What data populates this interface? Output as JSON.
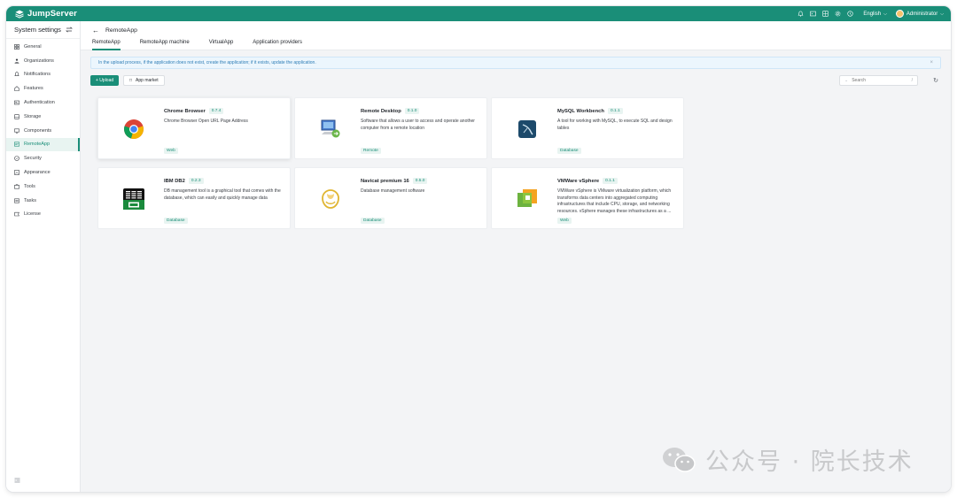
{
  "topbar": {
    "brand": "JumpServer",
    "language": "English",
    "user": "Administrator",
    "icons": [
      "bell-icon",
      "terminal-icon",
      "grid-icon",
      "gear-icon",
      "help-icon"
    ]
  },
  "sidebar": {
    "title": "System settings",
    "items": [
      {
        "label": "General",
        "icon": "general-icon"
      },
      {
        "label": "Organizations",
        "icon": "organizations-icon"
      },
      {
        "label": "Notifications",
        "icon": "bell-icon"
      },
      {
        "label": "Features",
        "icon": "home-icon"
      },
      {
        "label": "Authentication",
        "icon": "id-card-icon"
      },
      {
        "label": "Storage",
        "icon": "storage-icon"
      },
      {
        "label": "Components",
        "icon": "components-icon"
      },
      {
        "label": "RemoteApp",
        "icon": "remoteapp-icon"
      },
      {
        "label": "Security",
        "icon": "security-icon"
      },
      {
        "label": "Appearance",
        "icon": "appearance-icon"
      },
      {
        "label": "Tools",
        "icon": "tools-icon"
      },
      {
        "label": "Tasks",
        "icon": "tasks-icon"
      },
      {
        "label": "License",
        "icon": "license-icon"
      }
    ],
    "active": "RemoteApp"
  },
  "page": {
    "title": "RemoteApp",
    "tabs": [
      "RemoteApp",
      "RemoteApp machine",
      "VirtualApp",
      "Application providers"
    ],
    "active_tab": "RemoteApp"
  },
  "alert": "In the upload process, if the application does not exist, create the application; if it exists, update the application.",
  "toolbar": {
    "upload_label": "+ Upload",
    "market_label": "App market",
    "search_placeholder": "Search",
    "search_shortcut": "/"
  },
  "apps": [
    {
      "name": "Chrome Browser",
      "version": "0.7.4",
      "description": "Chrome Browser Open URL Page Address",
      "tag": "Web",
      "icon": "chrome-icon"
    },
    {
      "name": "Remote Desktop",
      "version": "0.1.0",
      "description": "Software that allows a user to access and operate another computer from a remote location",
      "tag": "Remote",
      "icon": "remote-desktop-icon"
    },
    {
      "name": "MySQL Workbench",
      "version": "0.1.1",
      "description": "A tool for working with MySQL, to execute SQL and design tables",
      "tag": "Database",
      "icon": "mysql-workbench-icon"
    },
    {
      "name": "IBM DB2",
      "version": "0.2.3",
      "description": "DB management tool is a graphical tool that comes with the database, which can easily and quickly manage data",
      "tag": "Database",
      "icon": "ibm-db2-icon"
    },
    {
      "name": "Navicat premium 16",
      "version": "0.5.0",
      "description": "Database management software",
      "tag": "Database",
      "icon": "navicat-icon"
    },
    {
      "name": "VMWare vSphere",
      "version": "0.1.1",
      "description": "VMWare vSphere is VMware virtualization platform, which transforms data centers into aggregated computing infrastructures that include CPU, storage, and networking resources. vSphere manages these infrastructures as a ...",
      "tag": "Web",
      "icon": "vsphere-icon"
    }
  ],
  "watermark": "公众号 · 院长技术",
  "colors": {
    "brand": "#1a8e78",
    "alert_bg": "#ecf6fd",
    "tag_bg": "#e8f4f1"
  }
}
